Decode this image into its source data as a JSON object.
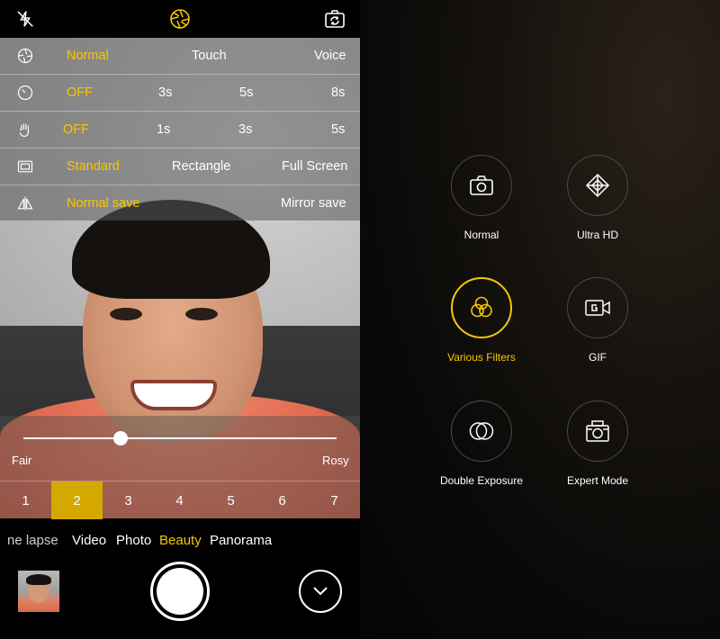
{
  "topbar": {
    "icons": [
      "flash-off-icon",
      "aperture-icon",
      "camera-switch-icon"
    ]
  },
  "settings": {
    "rows": [
      {
        "icon": "shutter-mode-icon",
        "options": [
          "Normal",
          "Touch",
          "Voice"
        ],
        "active": "Normal"
      },
      {
        "icon": "timer-icon",
        "options": [
          "OFF",
          "3s",
          "5s",
          "8s"
        ],
        "active": "OFF"
      },
      {
        "icon": "palm-gesture-icon",
        "options": [
          "OFF",
          "1s",
          "3s",
          "5s"
        ],
        "active": "OFF"
      },
      {
        "icon": "aspect-ratio-icon",
        "options": [
          "Standard",
          "Rectangle",
          "Full Screen"
        ],
        "active": "Standard"
      },
      {
        "icon": "mirror-icon",
        "options": [
          "Normal save",
          "Mirror save"
        ],
        "active": "Normal save"
      }
    ]
  },
  "beauty": {
    "left_label": "Fair",
    "right_label": "Rosy",
    "slider_value": 0.31,
    "levels": [
      "1",
      "2",
      "3",
      "4",
      "5",
      "6",
      "7"
    ],
    "active_level": "2"
  },
  "modes": {
    "items": [
      "ne lapse",
      "Video",
      "Photo",
      "Beauty",
      "Panorama"
    ],
    "active": "Beauty"
  },
  "camera_modes": [
    {
      "label": "Normal",
      "icon": "camera-icon",
      "active": false
    },
    {
      "label": "Ultra HD",
      "icon": "ultra-hd-icon",
      "active": false
    },
    {
      "label": "Various Filters",
      "icon": "filters-icon",
      "active": true
    },
    {
      "label": "GIF",
      "icon": "gif-icon",
      "active": false
    },
    {
      "label": "Double Exposure",
      "icon": "double-exposure-icon",
      "active": false
    },
    {
      "label": "Expert Mode",
      "icon": "expert-mode-icon",
      "active": false
    }
  ],
  "colors": {
    "accent": "#f6c800",
    "active_level_bg": "#d4a800"
  }
}
